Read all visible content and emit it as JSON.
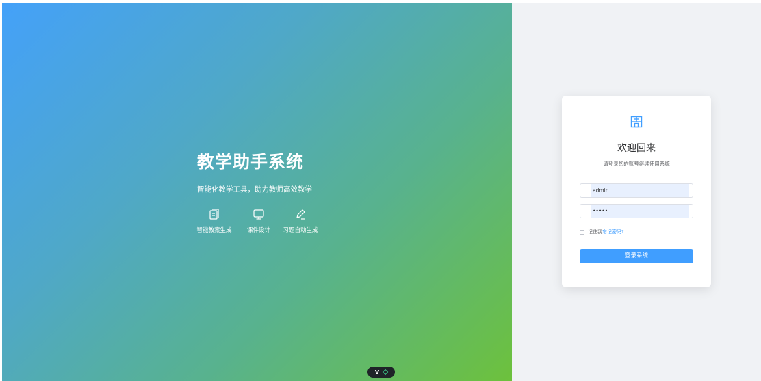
{
  "hero": {
    "title": "教学助手系统",
    "subtitle": "智能化教学工具，助力教师高效教学",
    "features": [
      {
        "label": "智能教案生成",
        "icon": "document-icon"
      },
      {
        "label": "课件设计",
        "icon": "monitor-icon"
      },
      {
        "label": "习题自动生成",
        "icon": "edit-pen-icon"
      }
    ],
    "dev_badge": {
      "text": "V",
      "icon": "diamond-icon"
    }
  },
  "login": {
    "logo_icon": "school-building-icon",
    "title": "欢迎回来",
    "subtitle": "请登录您的账号继续使用系统",
    "username": {
      "value": "admin"
    },
    "password": {
      "value": "•••••"
    },
    "remember_label": "记住我",
    "forgot_label": "忘记密码?",
    "submit_label": "登录系统"
  },
  "colors": {
    "accent": "#409eff",
    "gradient_start": "#44a1f9",
    "gradient_end": "#6dc13c",
    "right_bg": "#f0f2f5"
  }
}
